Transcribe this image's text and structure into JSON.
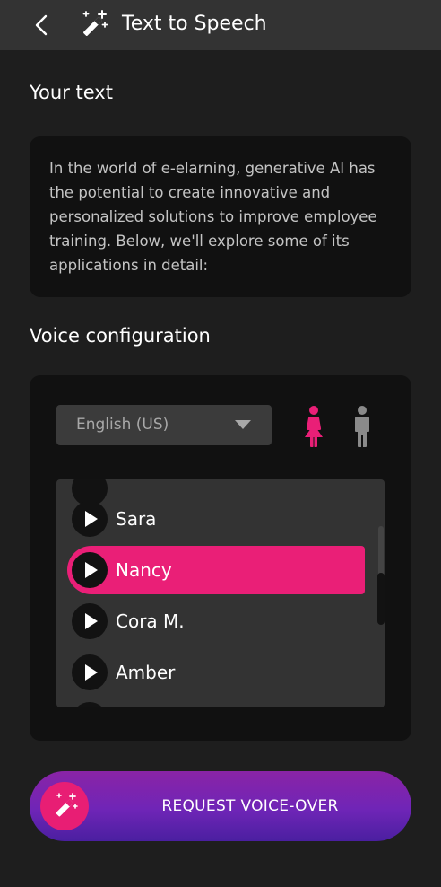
{
  "header": {
    "title": "Text to Speech",
    "back_icon": "chevron-left-icon",
    "app_icon": "magic-wand-icon"
  },
  "your_text": {
    "label": "Your text",
    "body": "In the world of e-elarning, generative AI has the potential to create innovative and personalized solutions to improve employee training. Below, we'll explore some of its applications in detail:"
  },
  "voice_config": {
    "label": "Voice configuration",
    "language": {
      "selected": "English (US)",
      "icon": "chevron-down-icon"
    },
    "gender": {
      "selected": "female",
      "female_icon": "female-person-icon",
      "male_icon": "male-person-icon"
    },
    "voices": [
      {
        "name": "Sara",
        "selected": false
      },
      {
        "name": "Nancy",
        "selected": true
      },
      {
        "name": "Cora M.",
        "selected": false
      },
      {
        "name": "Amber",
        "selected": false
      }
    ]
  },
  "cta": {
    "label": "REQUEST VOICE-OVER",
    "icon": "magic-wand-icon"
  },
  "colors": {
    "accent": "#ea1f77",
    "background": "#1e1e1e",
    "header": "#333333",
    "card": "#111111",
    "cta_gradient": [
      "#8a24a6",
      "#4a1fa0"
    ]
  }
}
